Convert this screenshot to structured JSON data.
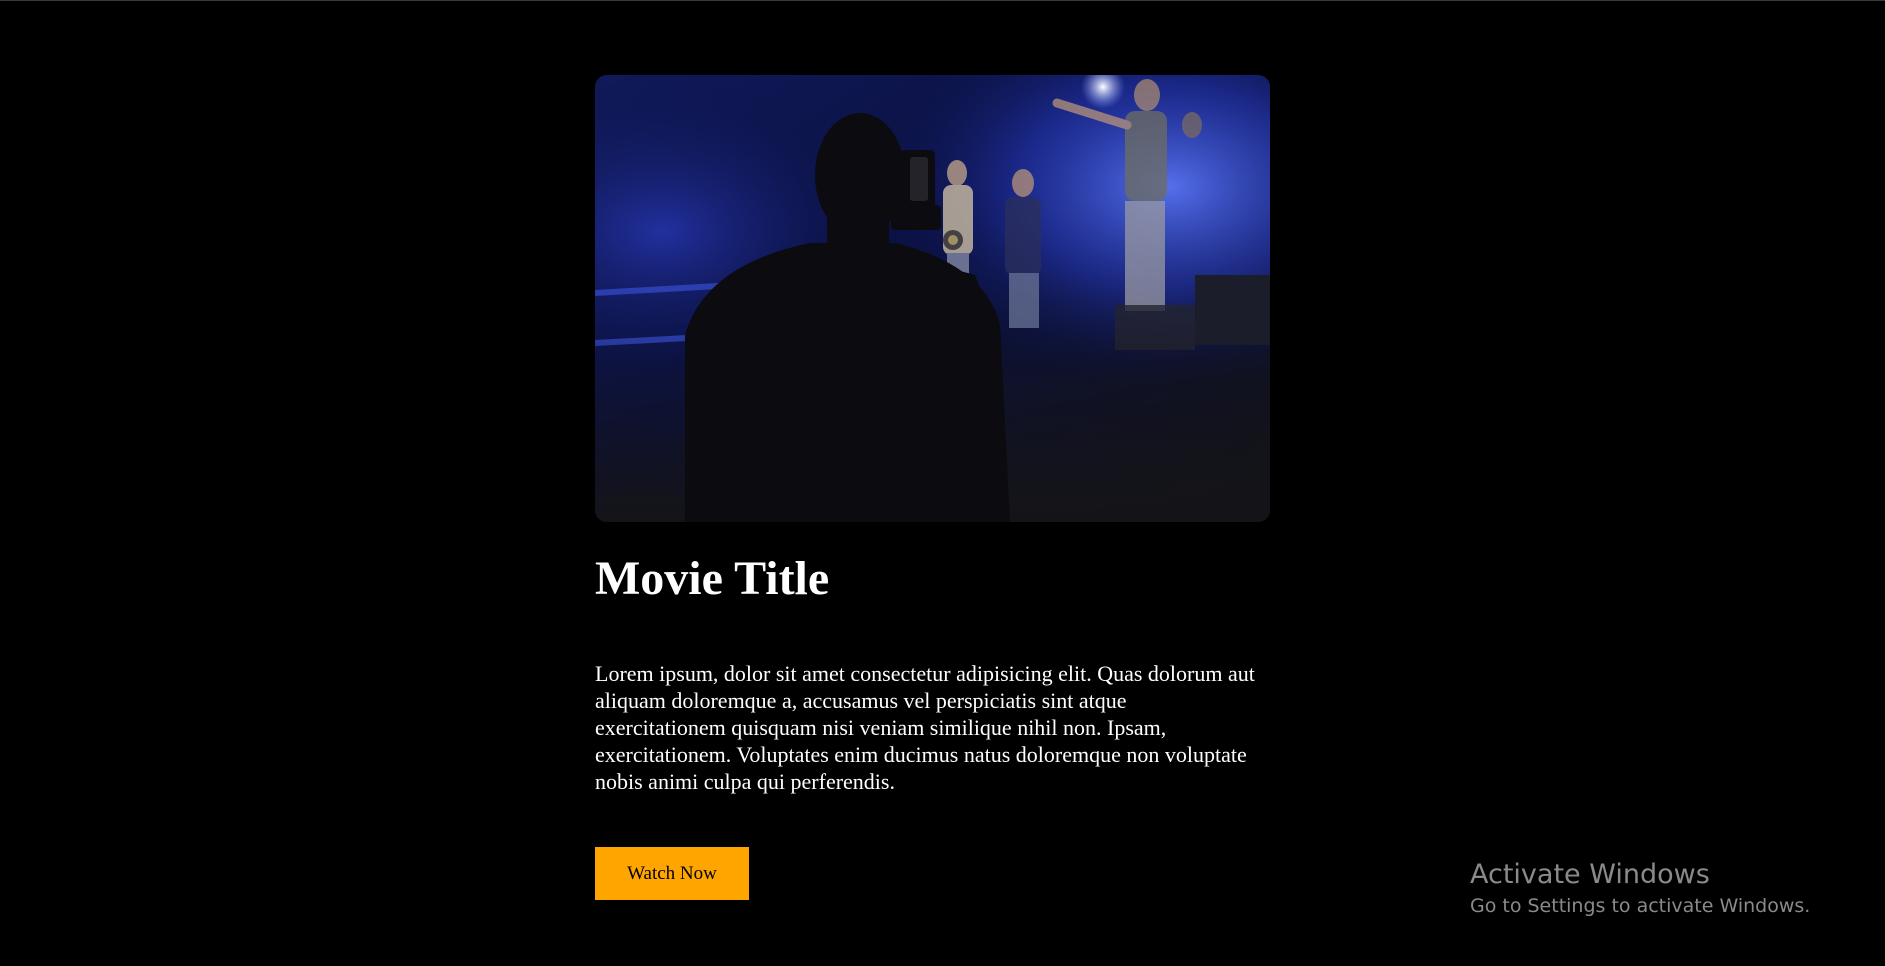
{
  "movie": {
    "title": "Movie Title",
    "description": "Lorem ipsum, dolor sit amet consectetur adipisicing elit. Quas dolorum aut aliquam doloremque a, accusamus vel perspiciatis sint atque exercitationem quisquam nisi veniam similique nihil non. Ipsam, exercitationem. Voluptates enim ducimus natus doloremque non voluptate nobis animi culpa qui perferendis.",
    "button_label": "Watch Now",
    "accent_color": "#ffa500"
  },
  "watermark": {
    "title": "Activate Windows",
    "subtitle": "Go to Settings to activate Windows."
  }
}
